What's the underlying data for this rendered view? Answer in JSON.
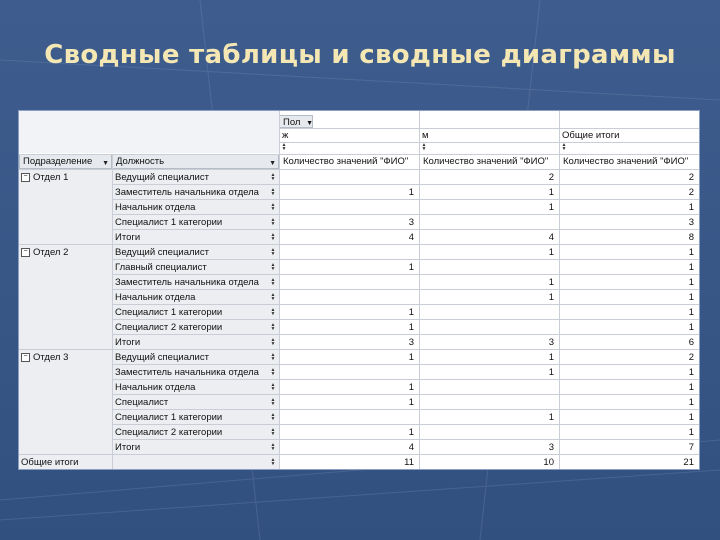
{
  "slide": {
    "title": "Сводные таблицы и сводные диаграммы"
  },
  "pivot": {
    "column_field": "Пол",
    "column_values": [
      "ж",
      "м",
      "Общие итоги"
    ],
    "row_fields": [
      "Подразделение",
      "Должность"
    ],
    "data_field": "Количество значений \"ФИО\"",
    "groups": [
      {
        "name": "Отдел 1",
        "rows": [
          {
            "position": "Ведущий специалист",
            "zh": "",
            "m": "2",
            "total": "2"
          },
          {
            "position": "Заместитель начальника отдела",
            "zh": "1",
            "m": "1",
            "total": "2"
          },
          {
            "position": "Начальник отдела",
            "zh": "",
            "m": "1",
            "total": "1"
          },
          {
            "position": "Специалист 1 категории",
            "zh": "3",
            "m": "",
            "total": "3"
          },
          {
            "position": "Итоги",
            "zh": "4",
            "m": "4",
            "total": "8"
          }
        ]
      },
      {
        "name": "Отдел 2",
        "rows": [
          {
            "position": "Ведущий специалист",
            "zh": "",
            "m": "1",
            "total": "1"
          },
          {
            "position": "Главный специалист",
            "zh": "1",
            "m": "",
            "total": "1"
          },
          {
            "position": "Заместитель начальника отдела",
            "zh": "",
            "m": "1",
            "total": "1"
          },
          {
            "position": "Начальник отдела",
            "zh": "",
            "m": "1",
            "total": "1"
          },
          {
            "position": "Специалист 1 категории",
            "zh": "1",
            "m": "",
            "total": "1"
          },
          {
            "position": "Специалист 2 категории",
            "zh": "1",
            "m": "",
            "total": "1"
          },
          {
            "position": "Итоги",
            "zh": "3",
            "m": "3",
            "total": "6"
          }
        ]
      },
      {
        "name": "Отдел 3",
        "rows": [
          {
            "position": "Ведущий специалист",
            "zh": "1",
            "m": "1",
            "total": "2"
          },
          {
            "position": "Заместитель начальника отдела",
            "zh": "",
            "m": "1",
            "total": "1"
          },
          {
            "position": "Начальник отдела",
            "zh": "1",
            "m": "",
            "total": "1"
          },
          {
            "position": "Специалист",
            "zh": "1",
            "m": "",
            "total": "1"
          },
          {
            "position": "Специалист 1 категории",
            "zh": "",
            "m": "1",
            "total": "1"
          },
          {
            "position": "Специалист 2 категории",
            "zh": "1",
            "m": "",
            "total": "1"
          },
          {
            "position": "Итоги",
            "zh": "4",
            "m": "3",
            "total": "7"
          }
        ]
      }
    ],
    "grand_total": {
      "label": "Общие итоги",
      "zh": "11",
      "m": "10",
      "total": "21"
    },
    "colors": {
      "slide_bg": "#3e5d8e",
      "title": "#f4e7b3",
      "grid": "#c9ced6"
    }
  }
}
